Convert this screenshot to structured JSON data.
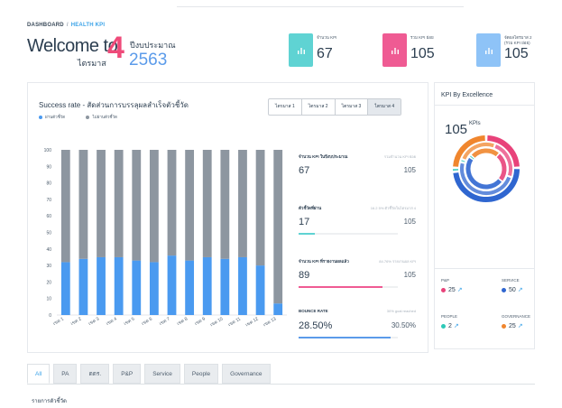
{
  "breadcrumb": {
    "root": "DASHBOARD",
    "separator": "/",
    "current": "HEALTH KPI"
  },
  "welcome": {
    "text": "Welcome to",
    "quarter_label": "ไตรมาส",
    "quarter_number": "4",
    "year_label": "ปีงบประมาณ",
    "year_number": "2563"
  },
  "kpi_cards": [
    {
      "label": "จำนวน KPI",
      "value": "67",
      "color": "#5fd3d3",
      "icon": "bar-chart-icon"
    },
    {
      "label": "รวม KPI ย่อย",
      "value": "105",
      "color": "#ef5b93",
      "icon": "bar-chart-icon"
    },
    {
      "label": "จัดผลไตรมาส 2\n(รวม KPI ย่อย)",
      "value": "105",
      "color": "#8ec3f7",
      "icon": "bar-chart-icon"
    }
  ],
  "success_panel": {
    "title": "Success rate - สัดส่วนการบรรลุผลสำเร็จตัวชี้วัด",
    "legend": [
      {
        "label": "ผ่านตัวชี้วัด",
        "color": "#4a9af0"
      },
      {
        "label": "ไม่ผ่านตัวชี้วัด",
        "color": "#8d96a0"
      }
    ],
    "quarter_tabs": [
      "ไตรมาส 1",
      "ไตรมาส 2",
      "ไตรมาส 3",
      "ไตรมาส 4"
    ],
    "active_quarter": 3
  },
  "chart_data": {
    "type": "bar",
    "stacked": true,
    "categories": [
      "เขต 1",
      "เขต 2",
      "เขต 3",
      "เขต 4",
      "เขต 5",
      "เขต 6",
      "เขต 7",
      "เขต 8",
      "เขต 9",
      "เขต 10",
      "เขต 11",
      "เขต 12",
      "เขต 13"
    ],
    "series": [
      {
        "name": "ผ่านตัวชี้วัด",
        "color": "#4a9af0",
        "values": [
          32,
          34,
          35,
          35,
          33,
          32,
          36,
          33,
          35,
          34,
          35,
          30,
          7
        ]
      },
      {
        "name": "ไม่ผ่านตัวชี้วัด",
        "color": "#8d96a0",
        "values": [
          68,
          66,
          65,
          65,
          67,
          68,
          64,
          67,
          65,
          66,
          65,
          70,
          93
        ]
      }
    ],
    "ylim": [
      0,
      100
    ],
    "yticks": [
      0,
      10,
      20,
      30,
      40,
      50,
      60,
      70,
      80,
      90,
      100
    ],
    "grid": false,
    "legend_position": "top-left",
    "title": "Success rate - สัดส่วนการบรรลุผลสำเร็จตัวชี้วัด",
    "xlabel": "",
    "ylabel": ""
  },
  "stats": [
    {
      "label": "จำนวน KPI ในปีงบประมาณ",
      "note": "รวมจำนวน KPI ย่อย",
      "value": "67",
      "max": "105",
      "percent": 0,
      "color": "#5fd3d3"
    },
    {
      "label": "ตัวชี้วัดที่ผ่าน",
      "note": "16.2 5% ตัวชี้วัดในไตรมาส 4",
      "value": "17",
      "max": "105",
      "percent": 16.2,
      "color": "#5fd3d3"
    },
    {
      "label": "จำนวน KPI ที่รายงานผลแล้ว",
      "note": "84.76% รายงานผล KPI",
      "value": "89",
      "max": "105",
      "percent": 84.76,
      "color": "#ef5b93"
    },
    {
      "label": "BOUNCE RATE",
      "note": "30% goal reached",
      "value": "28.50%",
      "max": "30.50%",
      "percent": 93,
      "color": "#5b9bea"
    }
  ],
  "kpi_excellence": {
    "title": "KPI By Excellence",
    "total": "105",
    "unit": "KPIs",
    "categories": [
      {
        "name": "P&P",
        "value": "25",
        "color": "#e8427a"
      },
      {
        "name": "SERVICE",
        "value": "50",
        "color": "#2f66d0"
      },
      {
        "name": "PEOPLE",
        "value": "2",
        "color": "#2ec9b8"
      },
      {
        "name": "GOVERNANCE",
        "value": "25",
        "color": "#f0862e"
      }
    ],
    "link_icon": "external-link-icon"
  },
  "bottom_tabs": [
    "All",
    "PA",
    "ตตร.",
    "P&P",
    "Service",
    "People",
    "Governance"
  ],
  "active_bottom_tab": 0,
  "section_label": "รายการตัวชี้วัด"
}
